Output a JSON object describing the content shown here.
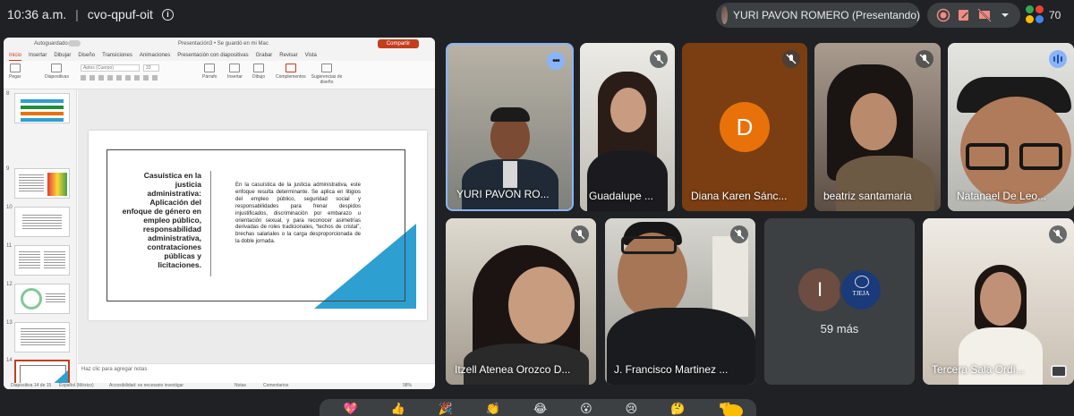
{
  "topbar": {
    "time": "10:36 a.m.",
    "meeting_code": "cvo-qpuf-oit",
    "presenter_label": "YURI PAVON ROMERO (Presentando)",
    "participant_count": "70"
  },
  "presentation": {
    "app": {
      "autosave_label": "Autoguardado",
      "doc_title": "Presentación3 • Se guardó en mi Mac",
      "share_label": "Compartir"
    },
    "tabs": [
      "Inicio",
      "Insertar",
      "Dibujar",
      "Diseño",
      "Transiciones",
      "Animaciones",
      "Presentación con diapositivas",
      "Grabar",
      "Revisar",
      "Vista"
    ],
    "ribbon": {
      "paste": "Pegar",
      "slides": "Diapositivas",
      "font_name": "Aptos (Cuerpo)",
      "font_size": "33",
      "paragraph": "Párrafo",
      "insert": "Insertar",
      "draw": "Dibujo",
      "addins": "Complementos",
      "design_ideas": "Sugerencias de diseño"
    },
    "thumbnail_numbers": [
      "8",
      "9",
      "10",
      "11",
      "12",
      "13",
      "14",
      "15"
    ],
    "slide": {
      "heading": "Casuística en la justicia administrativa: Aplicación del enfoque de género en empleo público, responsabilidad administrativa, contrataciones públicas y licitaciones.",
      "body": "En la casuística de la justicia administrativa, este enfoque resulta determinante. Se aplica en litigios del empleo público, seguridad social y responsabilidades para frenar despidos injustificados, discriminación por embarazo u orientación sexual, y para reconocer asimetrías derivadas de roles tradicionales, “techos de cristal”, brechas salariales o la carga desproporcionada de la doble jornada."
    },
    "notes_placeholder": "Haz clic para agregar notas",
    "status": {
      "slide_counter": "Diapositiva 14 de 15",
      "language": "Español (México)",
      "accessibility": "Accesibilidad: es necesario investigar",
      "notes": "Notas",
      "comments": "Comentarios",
      "zoom": "98%"
    }
  },
  "participants": [
    {
      "name": "YURI PAVON RO...",
      "state": "more"
    },
    {
      "name": "Guadalupe ...",
      "state": "muted"
    },
    {
      "name": "Diana Karen Sánc...",
      "state": "muted",
      "initial": "D"
    },
    {
      "name": "beatriz santamaria",
      "state": "muted"
    },
    {
      "name": "Natanael De Leo...",
      "state": "speaking"
    },
    {
      "name": "Itzell Atenea Orozco D...",
      "state": "muted"
    },
    {
      "name": "J. Francisco Martinez ...",
      "state": "muted"
    },
    {
      "name": "Tercera Sala Ordi...",
      "state": "muted"
    }
  ],
  "others": {
    "initial": "I",
    "logo_text": "TJEJA",
    "label": "59 más"
  },
  "reactions": [
    "💖",
    "👍",
    "🎉",
    "👏",
    "😂",
    "😮",
    "😢",
    "🤔",
    "👎"
  ],
  "colors": {
    "accent_blue": "#8ab4f8",
    "office_red": "#c43e1c",
    "avatar_orange": "#e8710a",
    "slide_triangle": "#2e9fd1"
  }
}
